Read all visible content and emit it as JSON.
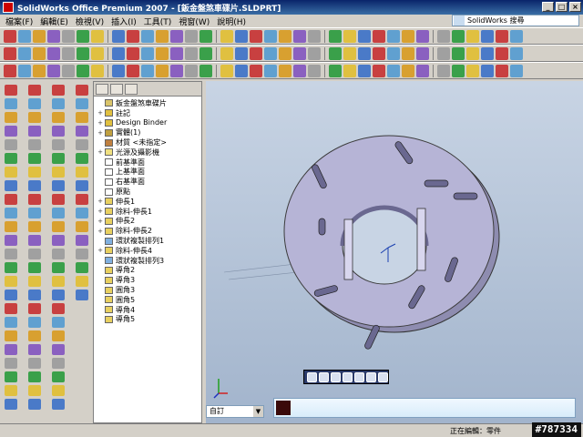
{
  "window": {
    "title": "SolidWorks Office Premium 2007 - [鈑金盤煞車碟片.SLDPRT]"
  },
  "menu": [
    "檔案(F)",
    "編輯(E)",
    "檢視(V)",
    "插入(I)",
    "工具(T)",
    "視窗(W)",
    "說明(H)"
  ],
  "search": {
    "label": "SolidWorks 搜尋"
  },
  "tree": [
    {
      "label": "鈑金盤煞車碟片",
      "exp": "",
      "color": "#d9c46a"
    },
    {
      "label": "註記",
      "exp": "+",
      "color": "#e0c040"
    },
    {
      "label": "Design Binder",
      "exp": "+",
      "color": "#e0c040"
    },
    {
      "label": "實體(1)",
      "exp": "+",
      "color": "#c0a040"
    },
    {
      "label": "材質 <未指定>",
      "exp": "",
      "color": "#c08040"
    },
    {
      "label": "光源及攝影機",
      "exp": "+",
      "color": "#f0e080"
    },
    {
      "label": "前基準面",
      "exp": "",
      "color": "#ffffff"
    },
    {
      "label": "上基準面",
      "exp": "",
      "color": "#ffffff"
    },
    {
      "label": "右基準面",
      "exp": "",
      "color": "#ffffff"
    },
    {
      "label": "原點",
      "exp": "",
      "color": "#ffffff"
    },
    {
      "label": "伸長1",
      "exp": "+",
      "color": "#e8d060"
    },
    {
      "label": "除料-伸長1",
      "exp": "+",
      "color": "#e8d060"
    },
    {
      "label": "伸長2",
      "exp": "+",
      "color": "#e8d060"
    },
    {
      "label": "除料-伸長2",
      "exp": "+",
      "color": "#e8d060"
    },
    {
      "label": "環狀複製排列1",
      "exp": "",
      "color": "#80b0e0"
    },
    {
      "label": "除料-伸長4",
      "exp": "+",
      "color": "#e8d060"
    },
    {
      "label": "環狀複製排列3",
      "exp": "",
      "color": "#80b0e0"
    },
    {
      "label": "導角2",
      "exp": "",
      "color": "#e8d060"
    },
    {
      "label": "導角3",
      "exp": "",
      "color": "#e8d060"
    },
    {
      "label": "圓角3",
      "exp": "",
      "color": "#e8d060"
    },
    {
      "label": "圓角5",
      "exp": "",
      "color": "#e8d060"
    },
    {
      "label": "導角4",
      "exp": "",
      "color": "#e8d060"
    },
    {
      "label": "導角5",
      "exp": "",
      "color": "#e8d060"
    }
  ],
  "view": {
    "selector": "自訂"
  },
  "status": {
    "text": "正在編輯：零件"
  },
  "watermark": "#787334",
  "colors": {
    "part": "#b6b4d6",
    "part_edge": "#3c3c3c",
    "background_top": "#c8d4e4",
    "background_bottom": "#a2b4cc",
    "title_bar": "#0a246a"
  }
}
